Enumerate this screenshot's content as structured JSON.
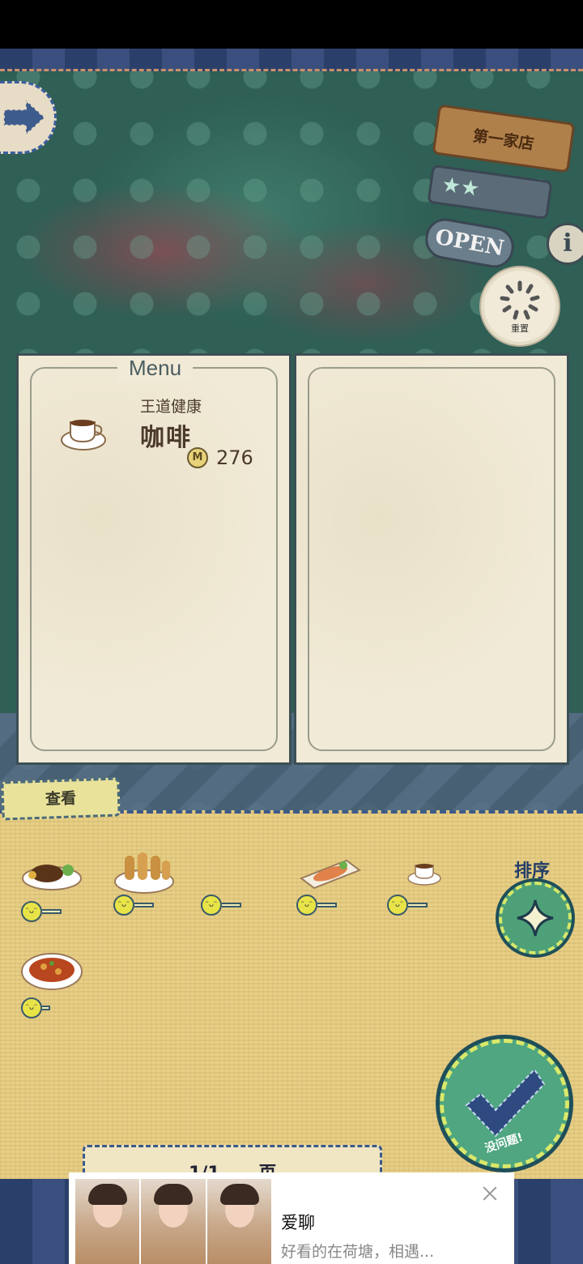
{
  "shop_sign": {
    "name": "第一家店",
    "stars": "★★",
    "status": "OPEN"
  },
  "buttons": {
    "info": "i",
    "reset": "重置"
  },
  "menu": {
    "title": "Menu",
    "item": {
      "subtitle": "王道健康",
      "name": "咖啡",
      "coin_symbol": "M",
      "price": "276"
    }
  },
  "tray": {
    "view_tab": "查看",
    "sort_label": "排序",
    "dishes": [
      {
        "name": "steak-dish"
      },
      {
        "name": "fried-skewers-dish"
      },
      {
        "name": "empty-slot"
      },
      {
        "name": "grilled-salmon-dish"
      },
      {
        "name": "coffee-dish"
      },
      {
        "name": "stir-fry-dish"
      }
    ],
    "confirm_label": "没问题!",
    "pager": {
      "page": "1/1",
      "unit": "页"
    }
  },
  "ad": {
    "title": "爱聊",
    "description": "好看的在荷塘，相遇..."
  },
  "colors": {
    "panel_border": "#3c4f55",
    "tray": "#e8cf86",
    "button_green": "#4fa680"
  }
}
